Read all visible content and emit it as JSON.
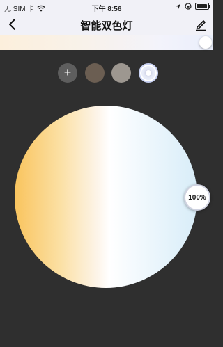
{
  "status_bar": {
    "carrier": "无 SIM 卡",
    "time": "下午 8:56"
  },
  "header": {
    "title": "智能双色灯"
  },
  "presets": {
    "add_label": "+"
  },
  "brightness": {
    "label": "100%"
  },
  "colors": {
    "warm": "#f9c45e",
    "neutral": "#ffffff",
    "cool": "#d8edf8",
    "background": "#2f2f2f"
  },
  "icons": {
    "back": "chevron-left-icon",
    "edit": "pencil-icon",
    "wifi": "wifi-icon",
    "location": "location-arrow-icon",
    "lock": "orientation-lock-icon",
    "battery": "battery-icon"
  }
}
